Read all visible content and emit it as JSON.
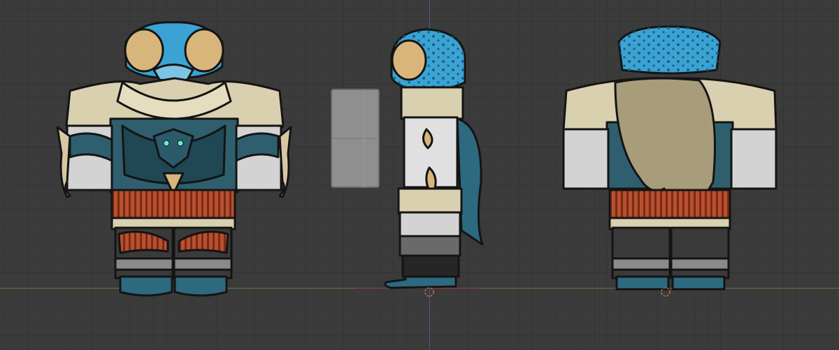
{
  "viewport": {
    "grid": true,
    "colors": {
      "background": "#3b3b3b",
      "grid_major": "#333333",
      "x_axis": "#5f7d3a",
      "y_axis": "#4c5f86"
    }
  },
  "figures": [
    {
      "view": "front"
    },
    {
      "view": "side"
    },
    {
      "view": "back"
    }
  ],
  "palette": {
    "blue": "#3aa3d4",
    "teal": "#2f5f6e",
    "cream": "#d9d0b0",
    "gold": "#d8b57a",
    "rust": "#b8502f",
    "silver": "#d3d3d3",
    "dark": "#2a2a2a",
    "hair": "#a89c7a"
  }
}
